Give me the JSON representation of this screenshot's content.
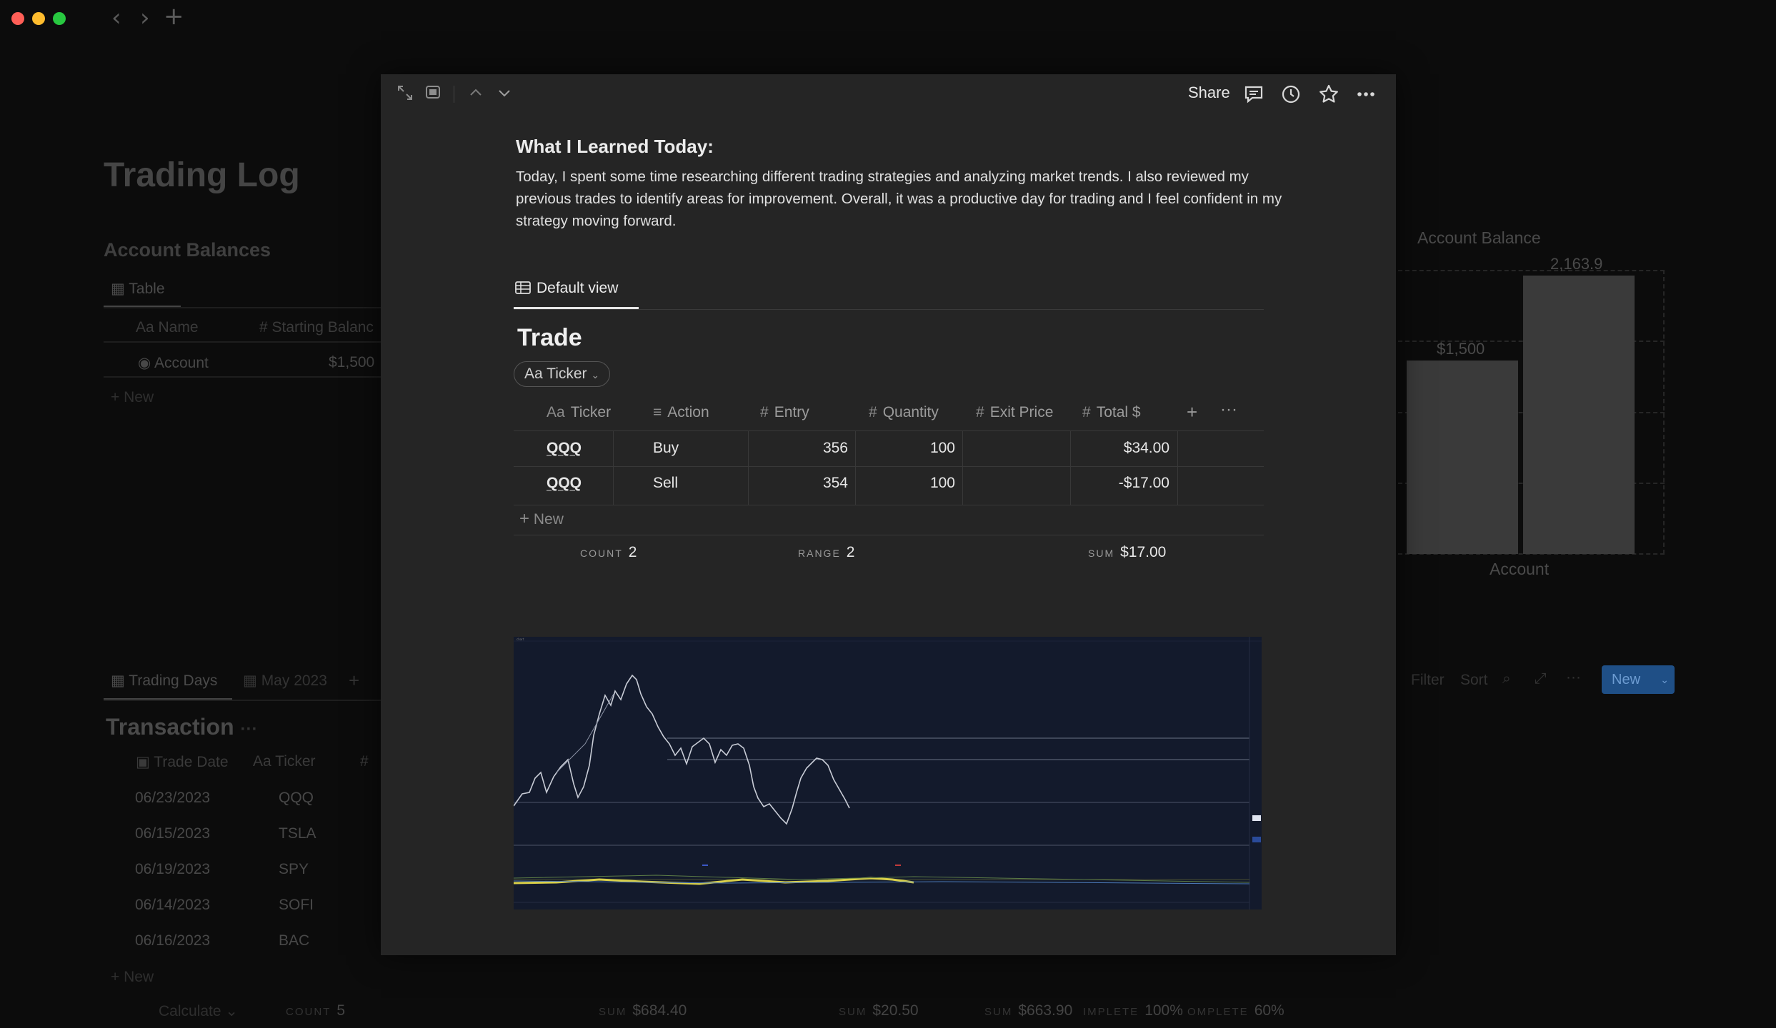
{
  "window": {
    "traffic_colors": [
      "#ff5f57",
      "#febc2e",
      "#28c840"
    ],
    "back_icon": "chevron-left-icon",
    "forward_icon": "chevron-right-icon",
    "new_tab_icon": "plus-icon"
  },
  "background": {
    "page_title": "Trading Log",
    "account_balances": {
      "heading": "Account Balances",
      "view_tab": "Table",
      "columns": [
        "Aa Name",
        "# Starting Balanc"
      ],
      "rows": [
        {
          "name": "Account",
          "starting_balance": "$1,500"
        }
      ],
      "new_label": "New"
    },
    "account_chart": {
      "title": "Account Balance",
      "xlabel": "Account",
      "bar_labels": [
        "$1,500",
        "2,163.9"
      ]
    },
    "trading_days": {
      "tabs": [
        "Trading Days",
        "May 2023"
      ],
      "heading": "Transaction",
      "columns": [
        "Trade Date",
        "Aa Ticker",
        "#"
      ],
      "rows": [
        {
          "date": "06/23/2023",
          "ticker": "QQQ"
        },
        {
          "date": "06/15/2023",
          "ticker": "TSLA"
        },
        {
          "date": "06/19/2023",
          "ticker": "SPY"
        },
        {
          "date": "06/14/2023",
          "ticker": "SOFI"
        },
        {
          "date": "06/16/2023",
          "ticker": "BAC"
        }
      ],
      "new_label": "New",
      "toolbar": {
        "filter": "Filter",
        "sort": "Sort",
        "new_button": "New"
      },
      "footer": {
        "calculate": "Calculate",
        "count_label": "COUNT",
        "count_value": "5",
        "sum1_label": "SUM",
        "sum1_value": "$684.40",
        "sum2_label": "SUM",
        "sum2_value": "$20.50",
        "sum3_label": "SUM",
        "sum3_value": "$663.90",
        "complete1_label": "IMPLETE",
        "complete1_value": "100%",
        "complete2_label": "OMPLETE",
        "complete2_value": "60%"
      }
    }
  },
  "modal": {
    "toolbar": {
      "share": "Share",
      "icons": [
        "expand-icon",
        "peek-mode-icon",
        "chevron-up-icon",
        "chevron-down-icon",
        "comment-icon",
        "history-icon",
        "star-icon",
        "more-icon"
      ]
    },
    "learned_heading": "What I Learned Today:",
    "learned_body": "Today, I spent some time researching different trading strategies and analyzing market trends. I also reviewed my previous trades to identify areas for improvement. Overall, it was a productive day for trading and I feel confident in my strategy moving forward.",
    "view_tab": "Default view",
    "db_title": "Trade",
    "filter_chip": "Aa Ticker",
    "columns": [
      {
        "icon": "Aa",
        "label": "Ticker"
      },
      {
        "icon": "≡",
        "label": "Action"
      },
      {
        "icon": "#",
        "label": "Entry"
      },
      {
        "icon": "#",
        "label": "Quantity"
      },
      {
        "icon": "#",
        "label": "Exit Price"
      },
      {
        "icon": "#",
        "label": "Total $"
      }
    ],
    "rows": [
      {
        "ticker": "QQQ",
        "action": "Buy",
        "entry": "356",
        "quantity": "100",
        "exit_price": "",
        "total": "$34.00"
      },
      {
        "ticker": "QQQ",
        "action": "Sell",
        "entry": "354",
        "quantity": "100",
        "exit_price": "",
        "total": "-$17.00"
      }
    ],
    "new_label": "New",
    "footer": {
      "count_label": "COUNT",
      "count_value": "2",
      "range_label": "RANGE",
      "range_value": "2",
      "sum_label": "SUM",
      "sum_value": "$17.00"
    },
    "chart_image": {
      "description_icon": "tradingview-chart-screenshot"
    }
  }
}
